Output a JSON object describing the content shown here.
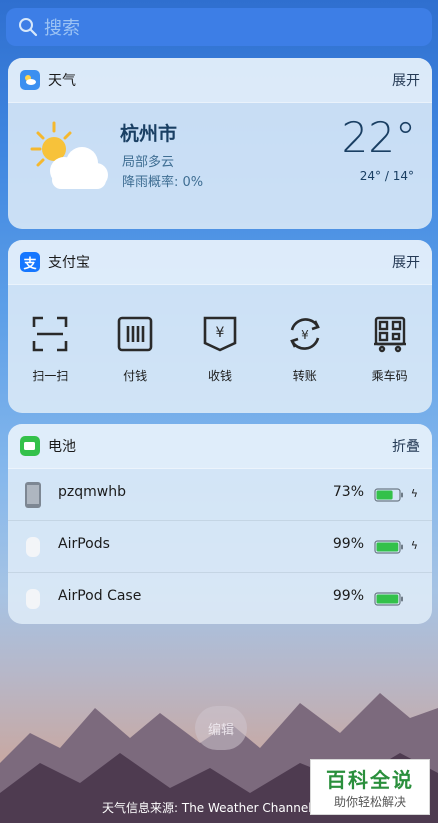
{
  "search": {
    "placeholder": "搜索",
    "icon": "search-icon"
  },
  "weather": {
    "title": "天气",
    "action": "展开",
    "city": "杭州市",
    "condition": "局部多云",
    "rain_chance": "降雨概率: 0%",
    "temperature": "22°",
    "range": "24° / 14°",
    "icon": "partly-cloudy-icon"
  },
  "alipay": {
    "title": "支付宝",
    "action": "展开",
    "items": [
      {
        "label": "扫一扫",
        "icon": "scan-icon"
      },
      {
        "label": "付钱",
        "icon": "pay-icon"
      },
      {
        "label": "收钱",
        "icon": "receive-money-icon"
      },
      {
        "label": "转账",
        "icon": "transfer-icon"
      },
      {
        "label": "乘车码",
        "icon": "transit-code-icon"
      }
    ]
  },
  "battery": {
    "title": "电池",
    "action": "折叠",
    "devices": [
      {
        "name": "pzqmwhb",
        "percent": "73%",
        "level": 0.73,
        "charging": true
      },
      {
        "name": "AirPods",
        "percent": "99%",
        "level": 0.99,
        "charging": true
      },
      {
        "name": "AirPod Case",
        "percent": "99%",
        "level": 0.99,
        "charging": false
      }
    ]
  },
  "edit_label": "编辑",
  "source_text": "天气信息来源: The Weather Channel",
  "watermark": {
    "line1": "百科全说",
    "line2": "助你轻松解决"
  },
  "colors": {
    "accent": "#3d7ee6",
    "battery_green": "#33c14a"
  }
}
